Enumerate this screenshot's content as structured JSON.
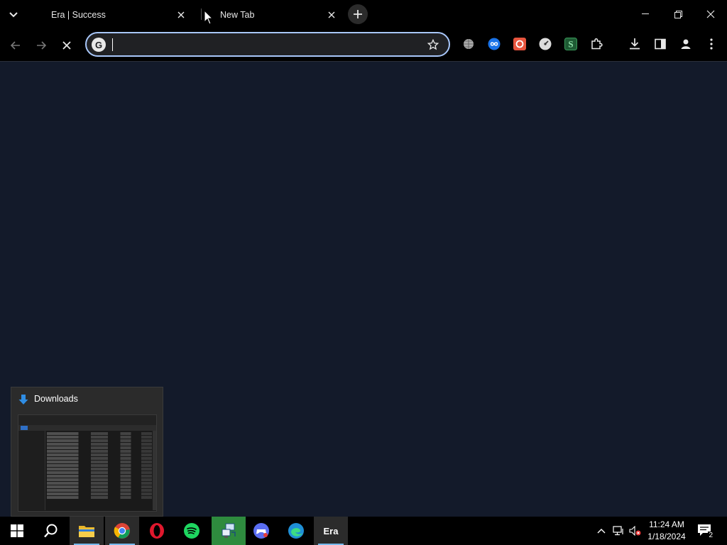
{
  "tabs": [
    {
      "title": "Era | Success",
      "active": false
    },
    {
      "title": "New Tab",
      "active": true
    }
  ],
  "omnibox": {
    "value": "",
    "placeholder": ""
  },
  "extensions": [
    "globe-extension-icon",
    "infinity-extension-icon",
    "red-circle-extension-icon",
    "speed-extension-icon",
    "s-extension-icon",
    "puzzle-icon"
  ],
  "preview": {
    "title": "Downloads"
  },
  "taskbar": {
    "era_label": "Era",
    "time": "11:24 AM",
    "date": "1/18/2024",
    "notifications": "2"
  },
  "colors": {
    "page_bg": "#131a2a",
    "omnibox_border": "#a8c7fa",
    "taskbar_active": "#76b9ed"
  }
}
